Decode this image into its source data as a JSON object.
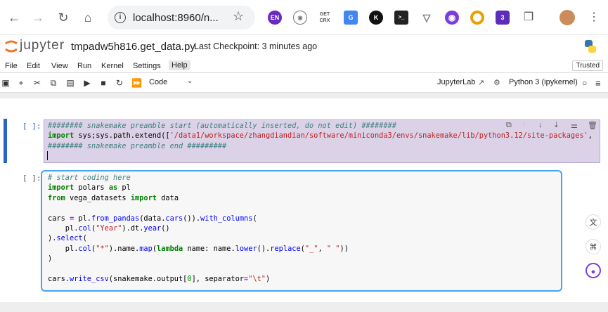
{
  "browser": {
    "url": "localhost:8960/n...",
    "extensions": [
      {
        "name": "en-icon",
        "label": "EN",
        "color": "#6a2ac2"
      },
      {
        "name": "openai-icon",
        "label": "",
        "color": "#888"
      },
      {
        "name": "get-crx-icon",
        "label": "GET CRX",
        "color": "#fff"
      },
      {
        "name": "translate-icon",
        "label": "G",
        "color": "#4285f4"
      },
      {
        "name": "k-icon",
        "label": "K",
        "color": "#111"
      },
      {
        "name": "terminal-icon",
        "label": ">_",
        "color": "#222"
      },
      {
        "name": "vue-icon",
        "label": "V",
        "color": "#777"
      },
      {
        "name": "ghost-icon",
        "label": "",
        "color": "#7a3ce0"
      },
      {
        "name": "chrome-ring-icon",
        "label": "",
        "color": "#e9a000"
      },
      {
        "name": "badge-icon",
        "label": "3",
        "color": "#5b2db8"
      }
    ]
  },
  "jupyter": {
    "brand": "jupyter",
    "notebook_name": "tmpadw5h816.get_data.py",
    "checkpoint": "Last Checkpoint: 3 minutes ago",
    "trusted": "Trusted",
    "menu": [
      "File",
      "Edit",
      "View",
      "Run",
      "Kernel",
      "Settings",
      "Help"
    ],
    "cell_type": "Code",
    "jupyterlab_label": "JupyterLab",
    "kernel_label": "Python 3 (ipykernel)"
  },
  "cells": {
    "prompt1": "[ ]:",
    "prompt2": "[ ]:"
  }
}
